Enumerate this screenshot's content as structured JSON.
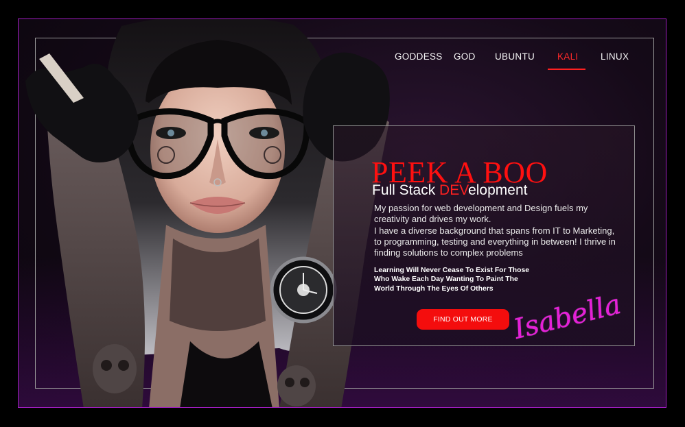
{
  "nav": {
    "items": [
      {
        "label": "GODDESS"
      },
      {
        "label": "GOD"
      },
      {
        "label": "UBUNTU"
      },
      {
        "label": "KALI",
        "active": true
      },
      {
        "label": "LINUX"
      }
    ]
  },
  "hero": {
    "title": "PEEK A BOO",
    "subtitle_prefix": "Full Stack ",
    "subtitle_accent": "DEV",
    "subtitle_suffix": "elopment",
    "paragraph_1": "My passion for web development and Design fuels my creativity and drives my work.",
    "paragraph_2": "I have a diverse background that spans from IT to Marketing, to programming, testing and everything in between! I thrive in finding solutions to complex problems",
    "quote": "Learning Will Never Cease To Exist For Those Who Wake Each Day Wanting To Paint The World Through The Eyes Of Others",
    "cta_label": "FIND OUT MORE",
    "signature": "Isabella"
  },
  "colors": {
    "accent": "#ff1010",
    "frame_border": "#a51fc6",
    "signature": "#e51fd8",
    "background": "#000000"
  }
}
